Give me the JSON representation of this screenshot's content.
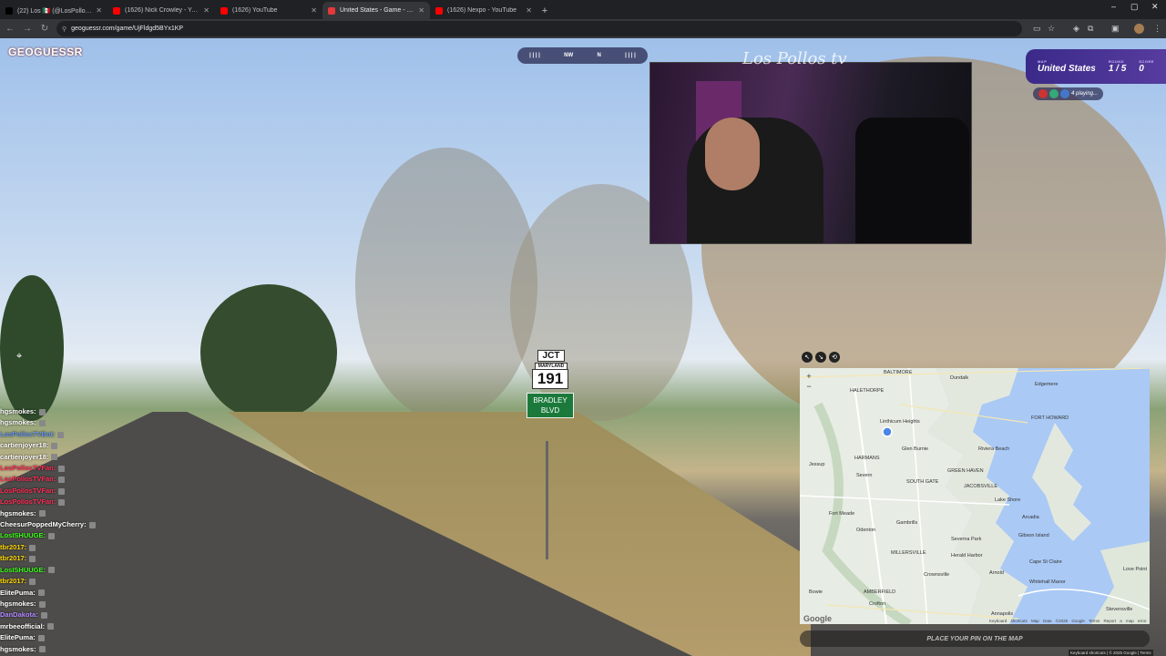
{
  "browser": {
    "tabs": [
      {
        "title": "(22) Los 🇲🇽 (@LosPollosTV) / X",
        "icon": "x-icon",
        "color": "#000000",
        "active": false
      },
      {
        "title": "(1626) Nick Crowley - YouTube",
        "icon": "youtube-icon",
        "color": "#ff0000",
        "active": false
      },
      {
        "title": "(1626) YouTube",
        "icon": "youtube-icon",
        "color": "#ff0000",
        "active": false
      },
      {
        "title": "United States - Game - GeoGuessr",
        "icon": "geoguessr-icon",
        "color": "#e5383b",
        "active": true
      },
      {
        "title": "(1626) Nexpo - YouTube",
        "icon": "youtube-icon",
        "color": "#ff0000",
        "active": false
      }
    ],
    "new_tab": "+",
    "url": "geoguessr.com/game/UjFldgd5BYx1KP",
    "window_controls": {
      "minimize": "–",
      "maximize": "▢",
      "close": "✕"
    }
  },
  "game": {
    "logo": "GEOGUESSR",
    "compass": {
      "left_ticks": "| | | |",
      "dir1": "NW",
      "dir2": "N",
      "right_ticks": "| | | |"
    },
    "stream_signature": "Los Pollos tv",
    "info": {
      "map_label": "MAP",
      "map_value": "United States",
      "round_label": "ROUND",
      "round_value": "1 / 5",
      "score_label": "SCORE",
      "score_value": "0"
    },
    "playing": "4 playing...",
    "pin_icon": "⌖",
    "sign": {
      "jct": "JCT",
      "state": "MARYLAND",
      "route": "191",
      "street_line1": "BRADLEY",
      "street_line2": "BLVD"
    },
    "guess_button": "PLACE YOUR PIN ON THE MAP"
  },
  "chat": [
    {
      "name": "hgsmokes:",
      "color": "#ffffff"
    },
    {
      "name": "hgsmokes:",
      "color": "#ffffff"
    },
    {
      "name": "LosPollosTVBot:",
      "color": "#6495ed"
    },
    {
      "name": "cartienjoyer18:",
      "color": "#ffffff"
    },
    {
      "name": "cartienjoyer18:",
      "color": "#ffffff"
    },
    {
      "name": "LosPollosTVFan:",
      "color": "#ff2d55"
    },
    {
      "name": "LosPollosTVFan:",
      "color": "#ff2d55"
    },
    {
      "name": "LosPollosTVFan:",
      "color": "#ff2d55"
    },
    {
      "name": "LosPollosTVFan:",
      "color": "#ff2d55"
    },
    {
      "name": "hgsmokes:",
      "color": "#ffffff"
    },
    {
      "name": "CheesurPoppedMyCherry:",
      "color": "#ffffff"
    },
    {
      "name": "LosISHUUGE:",
      "color": "#39ff14"
    },
    {
      "name": "tbr2017:",
      "color": "#ffd700"
    },
    {
      "name": "tbr2017:",
      "color": "#ffd700"
    },
    {
      "name": "LosISHUUGE:",
      "color": "#39ff14"
    },
    {
      "name": "tbr2017:",
      "color": "#ffd700"
    },
    {
      "name": "ElitePuma:",
      "color": "#ffffff"
    },
    {
      "name": "hgsmokes:",
      "color": "#ffffff"
    },
    {
      "name": "DanDakota:",
      "color": "#b388ff"
    },
    {
      "name": "mrbeeofficial:",
      "color": "#ffffff"
    },
    {
      "name": "ElitePuma:",
      "color": "#ffffff"
    },
    {
      "name": "hgsmokes:",
      "color": "#ffffff"
    }
  ],
  "minimap": {
    "controls": [
      "↖",
      "↘",
      "⟲"
    ],
    "zoom_in": "+",
    "zoom_out": "−",
    "labels": [
      {
        "t": "BALTIMORE",
        "k": "baltimore"
      },
      {
        "t": "Dundalk",
        "k": "dundalk"
      },
      {
        "t": "Edgemere",
        "k": "edgemere"
      },
      {
        "t": "HALETHORPE",
        "k": "halethorpe"
      },
      {
        "t": "Linthicum Heights",
        "k": "linthicum"
      },
      {
        "t": "FORT HOWARD",
        "k": "forthoward"
      },
      {
        "t": "Glen Burnie",
        "k": "glenburnie"
      },
      {
        "t": "Riviera Beach",
        "k": "riviera"
      },
      {
        "t": "HARMANS",
        "k": "harmans"
      },
      {
        "t": "Jessup",
        "k": "jessup"
      },
      {
        "t": "Severn",
        "k": "severn"
      },
      {
        "t": "GREEN HAVEN",
        "k": "greenhaven"
      },
      {
        "t": "SOUTH GATE",
        "k": "southgate"
      },
      {
        "t": "JACOBSVILLE",
        "k": "jacobsville"
      },
      {
        "t": "Fort Meade",
        "k": "fortmeade"
      },
      {
        "t": "Lake Shore",
        "k": "lakeshore"
      },
      {
        "t": "Arcadia",
        "k": "arcadia"
      },
      {
        "t": "Odenton",
        "k": "odenton"
      },
      {
        "t": "Gambrills",
        "k": "gambrills"
      },
      {
        "t": "Gibson Island",
        "k": "gibson"
      },
      {
        "t": "Severna Park",
        "k": "severnapark"
      },
      {
        "t": "MILLERSVILLE",
        "k": "millersville"
      },
      {
        "t": "Herald Harbor",
        "k": "herald"
      },
      {
        "t": "Cape St Claire",
        "k": "capestclaire"
      },
      {
        "t": "Crownsville",
        "k": "crownsville"
      },
      {
        "t": "Arnold",
        "k": "arnold"
      },
      {
        "t": "Whitehall Manor",
        "k": "whitehall"
      },
      {
        "t": "Bowie",
        "k": "bowie"
      },
      {
        "t": "AMBERFIELD",
        "k": "amberfield"
      },
      {
        "t": "Crofton",
        "k": "crofton"
      },
      {
        "t": "Annapolis",
        "k": "annapolis"
      },
      {
        "t": "Love Point",
        "k": "lovepoint"
      },
      {
        "t": "Stevensville",
        "k": "stevensville"
      }
    ],
    "attribution": "Keyboard shortcuts   Map Data ©2025 Google   Terms   Report a map error",
    "google": "Google",
    "keyboard_footer": "Keyboard shortcuts | © 2025 Google | Terms"
  }
}
